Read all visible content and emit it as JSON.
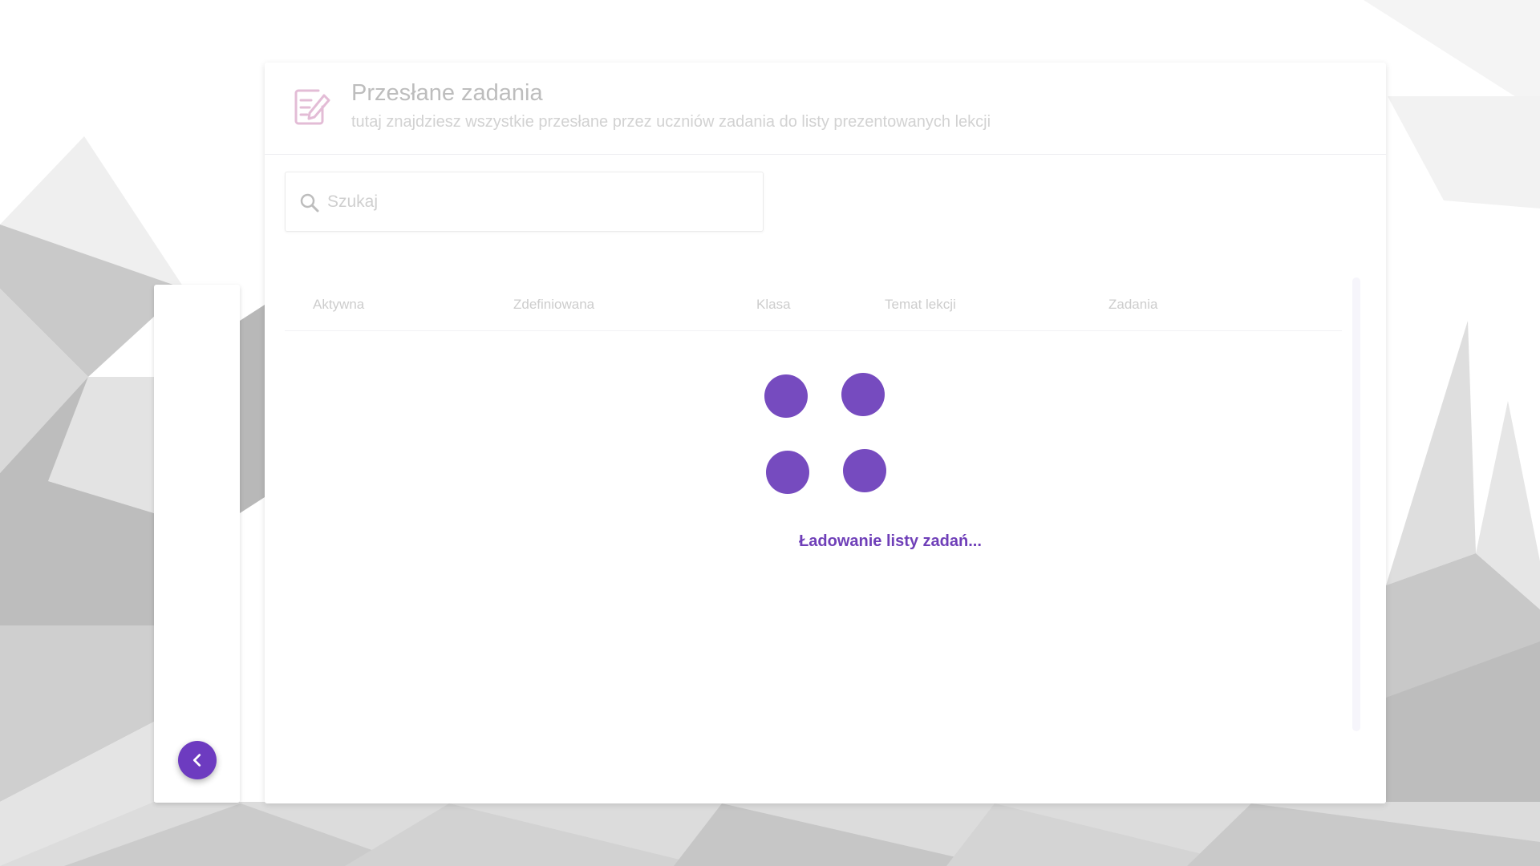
{
  "colors": {
    "accent": "#764bbf",
    "loading_text": "#6f3fb8",
    "button": "#6d3bc0",
    "title": "#bdbdbd",
    "subtitle": "#d2d2d2"
  },
  "header": {
    "icon": "edit-document-icon",
    "title": "Przesłane zadania",
    "subtitle": "tutaj znajdziesz wszystkie przesłane przez uczniów zadania do listy prezentowanych lekcji"
  },
  "search": {
    "icon": "search-icon",
    "placeholder": "Szukaj",
    "value": ""
  },
  "table": {
    "columns": [
      "Aktywna",
      "Zdefiniowana",
      "Klasa",
      "Temat lekcji",
      "Zadania"
    ]
  },
  "loader": {
    "text": "Ładowanie listy zadań..."
  },
  "sidebar": {
    "collapse_icon": "chevron-left-icon"
  }
}
